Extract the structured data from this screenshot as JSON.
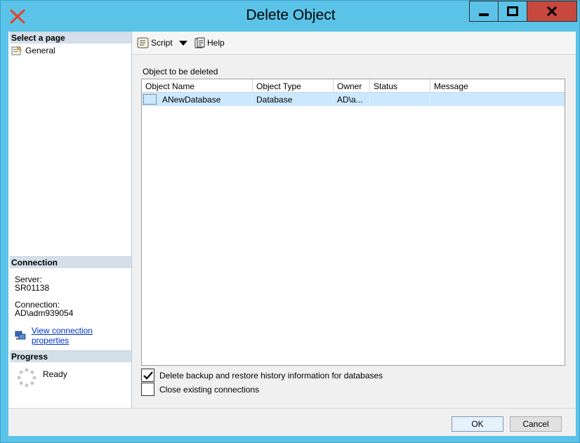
{
  "window": {
    "title": "Delete Object"
  },
  "left": {
    "select_page_header": "Select a page",
    "pages": [
      {
        "label": "General"
      }
    ],
    "connection_header": "Connection",
    "server_label": "Server:",
    "server_value": "SR01138",
    "connection_label": "Connection:",
    "connection_value": "AD\\adm939054",
    "view_connection_link": "View connection properties",
    "progress_header": "Progress",
    "progress_status": "Ready"
  },
  "toolbar": {
    "script_label": "Script",
    "help_label": "Help"
  },
  "main": {
    "group_label": "Object to be deleted",
    "columns": [
      "Object Name",
      "Object Type",
      "Owner",
      "Status",
      "Message"
    ],
    "rows": [
      {
        "object_name": "ANewDatabase",
        "object_type": "Database",
        "owner": "AD\\a...",
        "status": "",
        "message": ""
      }
    ],
    "options": {
      "delete_backup": {
        "label": "Delete backup and restore history information for databases",
        "checked": true
      },
      "close_connections": {
        "label": "Close existing connections",
        "checked": false
      }
    }
  },
  "buttons": {
    "ok": "OK",
    "cancel": "Cancel"
  },
  "colors": {
    "titlebar": "#5bc3e8",
    "close_button": "#c8483e",
    "selection": "#cce8ff",
    "link": "#0033cc"
  }
}
